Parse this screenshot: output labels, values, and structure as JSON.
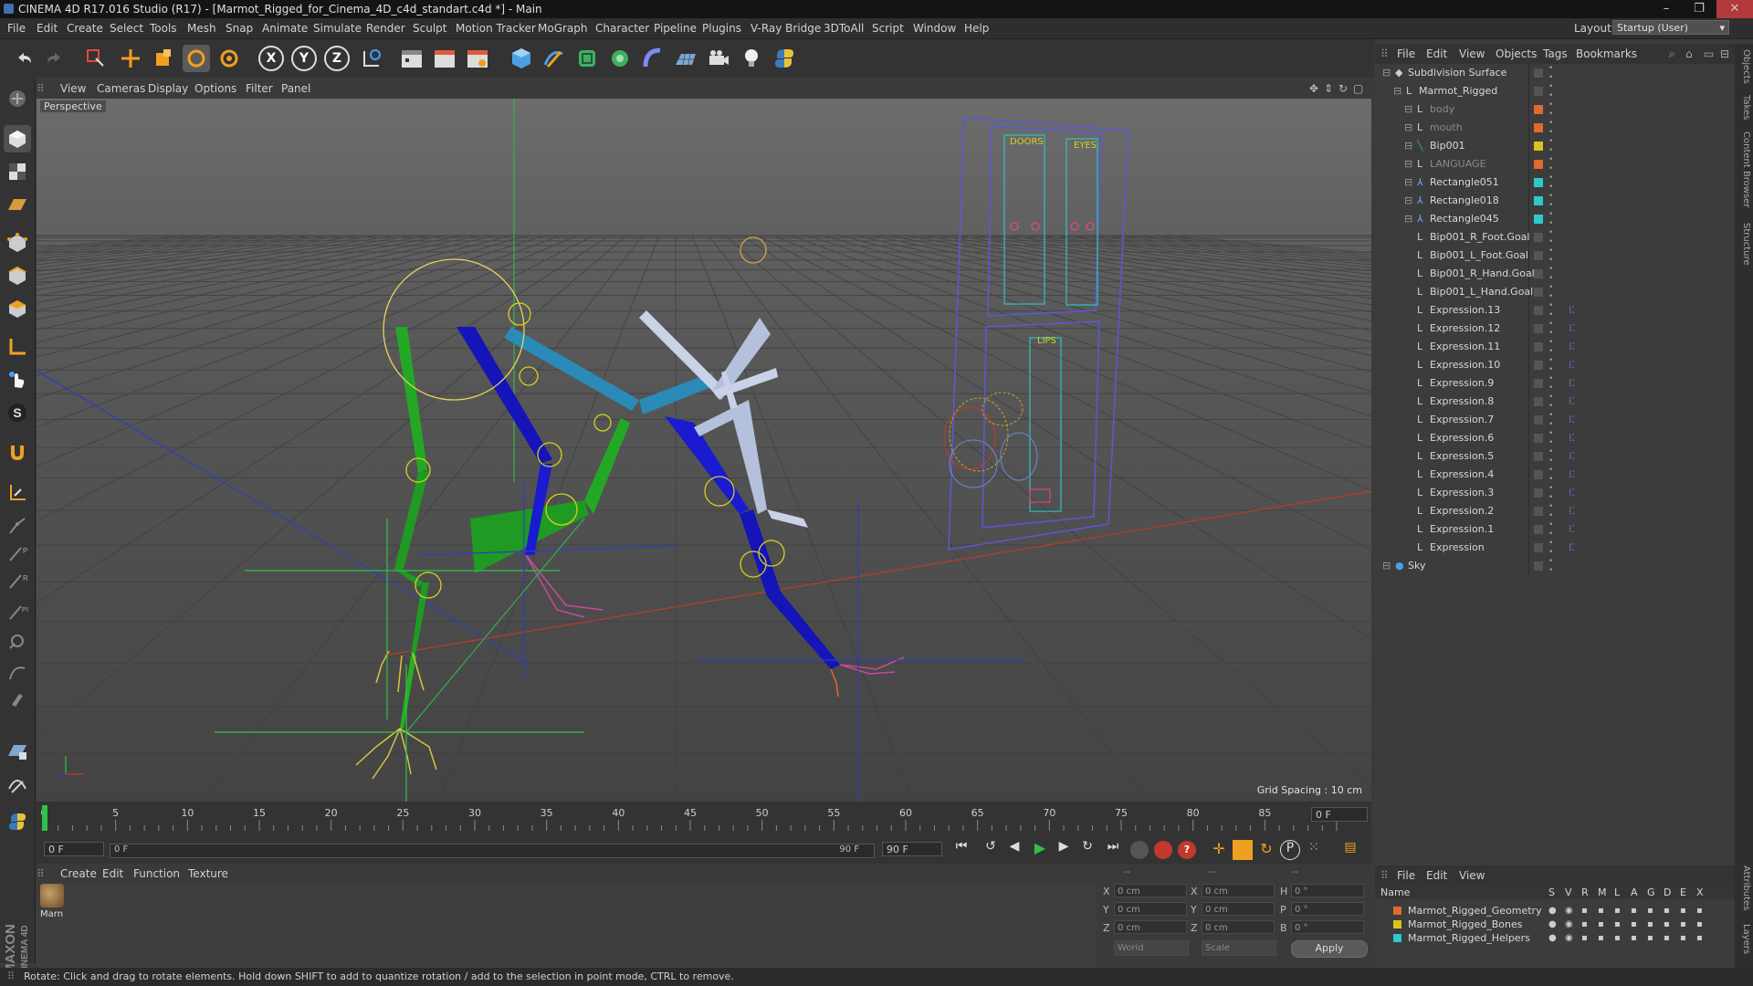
{
  "window": {
    "title": "CINEMA 4D R17.016 Studio (R17) - [Marmot_Rigged_for_Cinema_4D_c4d_standart.c4d *] - Main",
    "controls": [
      "–",
      "❐",
      "✕"
    ]
  },
  "menubar": {
    "items": [
      "File",
      "Edit",
      "Create",
      "Select",
      "Tools",
      "Mesh",
      "Snap",
      "Animate",
      "Simulate",
      "Render",
      "Sculpt",
      "Motion Tracker",
      "MoGraph",
      "Character",
      "Pipeline",
      "Plugins",
      "V-Ray Bridge",
      "3DToAll",
      "Script",
      "Window",
      "Help"
    ],
    "layout_label": "Layout:",
    "layout_value": "Startup (User)"
  },
  "toolbar": {
    "axis_x": "X",
    "axis_y": "Y",
    "axis_z": "Z"
  },
  "viewport": {
    "menu": [
      "View",
      "Cameras",
      "Display",
      "Options",
      "Filter",
      "Panel"
    ],
    "label": "Perspective",
    "grid_spacing": "Grid Spacing : 10 cm",
    "door_label_1": "DOORS",
    "door_label_2": "EYES",
    "door_label_3": "LIPS"
  },
  "timeline": {
    "ticks": [
      "0",
      "5",
      "10",
      "15",
      "20",
      "25",
      "30",
      "35",
      "40",
      "45",
      "50",
      "55",
      "60",
      "65",
      "70",
      "75",
      "80",
      "85",
      "90"
    ],
    "current_frame_right": "0 F",
    "start_frame": "0 F",
    "range_start": "0 F",
    "range_end": "90 F",
    "end_frame": "90 F"
  },
  "material_manager": {
    "menu": [
      "Create",
      "Edit",
      "Function",
      "Texture"
    ],
    "material_name": "Marn"
  },
  "coords": {
    "headers": [
      "--",
      "--",
      "--"
    ],
    "rows": [
      {
        "a": "X",
        "av": "0 cm",
        "b": "X",
        "bv": "0 cm",
        "c": "H",
        "cv": "0 °"
      },
      {
        "a": "Y",
        "av": "0 cm",
        "b": "Y",
        "bv": "0 cm",
        "c": "P",
        "cv": "0 °"
      },
      {
        "a": "Z",
        "av": "0 cm",
        "b": "Z",
        "bv": "0 cm",
        "c": "B",
        "cv": "0 °"
      }
    ],
    "mode1": "World",
    "mode2": "Scale",
    "apply": "Apply"
  },
  "object_manager": {
    "menu": [
      "File",
      "Edit",
      "View",
      "Objects",
      "Tags",
      "Bookmarks"
    ],
    "objects": [
      {
        "name": "Subdivision Surface",
        "indent": 0,
        "color": "#d8d8d8",
        "icon": "subdivision-icon"
      },
      {
        "name": "Marmot_Rigged",
        "indent": 1,
        "color": "#d8d8d8",
        "icon": "null-icon"
      },
      {
        "name": "body",
        "indent": 2,
        "color": "#8a8a8a",
        "icon": "joint-icon"
      },
      {
        "name": "mouth",
        "indent": 2,
        "color": "#8a8a8a",
        "icon": "joint-icon"
      },
      {
        "name": "Bip001",
        "indent": 2,
        "color": "#d8d8d8",
        "icon": "bone-icon"
      },
      {
        "name": "LANGUAGE",
        "indent": 2,
        "color": "#8a8a8a",
        "icon": "joint-icon"
      },
      {
        "name": "Rectangle051",
        "indent": 2,
        "color": "#d8d8d8",
        "icon": "spline-icon"
      },
      {
        "name": "Rectangle018",
        "indent": 2,
        "color": "#d8d8d8",
        "icon": "spline-icon"
      },
      {
        "name": "Rectangle045",
        "indent": 2,
        "color": "#d8d8d8",
        "icon": "spline-icon"
      },
      {
        "name": "Bip001_R_Foot.Goal",
        "indent": 2,
        "color": "#d8d8d8",
        "icon": "null-icon"
      },
      {
        "name": "Bip001_L_Foot.Goal",
        "indent": 2,
        "color": "#d8d8d8",
        "icon": "null-icon"
      },
      {
        "name": "Bip001_R_Hand.Goal",
        "indent": 2,
        "color": "#d8d8d8",
        "icon": "null-icon"
      },
      {
        "name": "Bip001_L_Hand.Goal",
        "indent": 2,
        "color": "#d8d8d8",
        "icon": "null-icon"
      },
      {
        "name": "Expression.13",
        "indent": 2,
        "color": "#d8d8d8",
        "icon": "null-icon"
      },
      {
        "name": "Expression.12",
        "indent": 2,
        "color": "#d8d8d8",
        "icon": "null-icon"
      },
      {
        "name": "Expression.11",
        "indent": 2,
        "color": "#d8d8d8",
        "icon": "null-icon"
      },
      {
        "name": "Expression.10",
        "indent": 2,
        "color": "#d8d8d8",
        "icon": "null-icon"
      },
      {
        "name": "Expression.9",
        "indent": 2,
        "color": "#d8d8d8",
        "icon": "null-icon"
      },
      {
        "name": "Expression.8",
        "indent": 2,
        "color": "#d8d8d8",
        "icon": "null-icon"
      },
      {
        "name": "Expression.7",
        "indent": 2,
        "color": "#d8d8d8",
        "icon": "null-icon"
      },
      {
        "name": "Expression.6",
        "indent": 2,
        "color": "#d8d8d8",
        "icon": "null-icon"
      },
      {
        "name": "Expression.5",
        "indent": 2,
        "color": "#d8d8d8",
        "icon": "null-icon"
      },
      {
        "name": "Expression.4",
        "indent": 2,
        "color": "#d8d8d8",
        "icon": "null-icon"
      },
      {
        "name": "Expression.3",
        "indent": 2,
        "color": "#d8d8d8",
        "icon": "null-icon"
      },
      {
        "name": "Expression.2",
        "indent": 2,
        "color": "#d8d8d8",
        "icon": "null-icon"
      },
      {
        "name": "Expression.1",
        "indent": 2,
        "color": "#d8d8d8",
        "icon": "null-icon"
      },
      {
        "name": "Expression",
        "indent": 2,
        "color": "#d8d8d8",
        "icon": "null-icon"
      },
      {
        "name": "Sky",
        "indent": 0,
        "color": "#d8d8d8",
        "icon": "sky-icon"
      }
    ]
  },
  "layer_manager": {
    "menu": [
      "File",
      "Edit",
      "View"
    ],
    "col_name": "Name",
    "cols": [
      "S",
      "V",
      "R",
      "M",
      "L",
      "A",
      "G",
      "D",
      "E",
      "X"
    ],
    "layers": [
      {
        "name": "Marmot_Rigged_Geometry",
        "color": "#e06a2a"
      },
      {
        "name": "Marmot_Rigged_Bones",
        "color": "#d9c21f"
      },
      {
        "name": "Marmot_Rigged_Helpers",
        "color": "#2fc9c9"
      }
    ]
  },
  "side_tabs": [
    "Objects",
    "Takes",
    "Content Browser",
    "Structure",
    "Attributes",
    "Layers"
  ],
  "maxon_logo": "MAXON",
  "maxon_sub": "CINEMA 4D",
  "status": "Rotate: Click and drag to rotate elements. Hold down SHIFT to add to quantize rotation / add to the selection in point mode, CTRL to remove."
}
